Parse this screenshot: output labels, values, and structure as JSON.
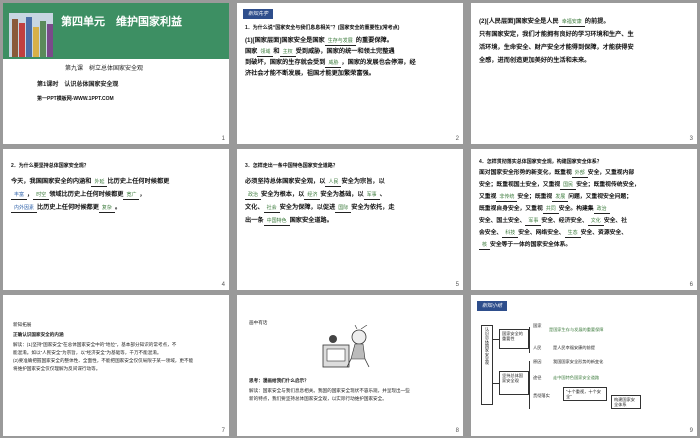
{
  "slides": [
    {
      "num": "1",
      "corner": "",
      "unit": "第四单元　维护国家利益",
      "lesson": "第九课　树立总体国家安全观",
      "period": "第1课时　认识总体国家安全观",
      "site": "第一PPT模板网-WWW.1PPT.COM"
    },
    {
      "num": "2",
      "corner": "",
      "tag": "新知先学",
      "q": "1．为什么说“国家安全与我们息息相关”？(国家安全的重要性)(常考点)",
      "l1": "(1)[国家层面]国家安全是国家",
      "a1": "生存与发展",
      "l1b": "的重要保障。",
      "l2a": "国家",
      "a2": "领域",
      "l2b": "和",
      "a3": "主权",
      "l2c": "受到威胁，国家的统一和领土完整遇",
      "l3": "到破坏，国家的生存就会受到",
      "a4": "威胁",
      "l3b": "，国家的发展也会停滞，经",
      "l4": "济社会才能不断发展，祖国才能更加繁荣富强。"
    },
    {
      "num": "3",
      "corner": "",
      "l1": "(2)[人民层面]国家安全是人民",
      "a1": "幸福安康",
      "l1b": "的前提。",
      "l2": "只有国家安定，我们才能拥有良好的学习环境和生产、生",
      "l3": "活环境，生命安全、财产安全才能得到保障，才能获得安",
      "l4": "全感，进而创造更加美好的生活和未来。"
    },
    {
      "num": "4",
      "corner": "",
      "q": "2．为什么要坚持总体国家安全观？",
      "l1": "今天，我国国家安全的内涵和",
      "a1": "外延",
      "l1b": "比历史上任何时候都更",
      "a2": "丰富",
      "l2b": "，",
      "a3": "时空",
      "l2c": "领域比历史上任何时候都更",
      "a4": "宽广",
      "a5": "内外因素",
      "l3b": "比历史上任何时候都更",
      "a6": "复杂"
    },
    {
      "num": "5",
      "corner": "",
      "q": "3．怎样走出一条中国特色国家安全道路？",
      "l1": "必须坚持总体国家安全观，以",
      "a1": "人民",
      "l1b": "安全为宗旨，以",
      "a2": "政治",
      "l2b": "安全为根本，以",
      "a3": "经济",
      "l2c": "安全为基础，以",
      "a4": "军事",
      "l3a": "文化、",
      "a5": "社会",
      "l3b": "安全为保障，以促进",
      "a6": "国际",
      "l3c": "安全为依托，走",
      "l4a": "出一条",
      "a7": "中国特色",
      "l4b": "国家安全道路。"
    },
    {
      "num": "6",
      "corner": "",
      "q": "4．怎样贯彻落实总体国家安全观，构建国家安全体系？",
      "l1": "面对国家安全形势的新变化，既重视",
      "a1": "外部",
      "l1b": "安全，又重视内部",
      "l2": "安全；既重视国土安全，又重视",
      "a2": "国民",
      "l2b": "安全；既重视传统安全，",
      "l3": "又重视",
      "a3": "非传统",
      "l3b": "安全；既重视",
      "a4": "发展",
      "l3c": "问题，又重视安全问题；",
      "l4": "既重视自身安全，又重视",
      "a5": "共同",
      "l4b": "安全。构建集",
      "a6": "政治",
      "l5": "安全、国土安全、",
      "a7": "军事",
      "l5b": "安全、经济安全、",
      "a8": "文化",
      "l5c": "安全、社",
      "l6": "会安全、",
      "a9": "科技",
      "l6b": "安全、网络安全、",
      "a10": "生态",
      "l6c": "安全、资源安全、",
      "a11": "核",
      "l7b": "安全等于一体的国家安全体系。"
    },
    {
      "num": "7",
      "corner": "",
      "title": "新知拓展",
      "sub": "正确认识国家安全的内涵",
      "l1": "解读：(1)坚持“国家安全”在总体国家安全中的“地位”，基本部分知识的常考点，不",
      "l2": "能混淆。如以“人民安全”为宗旨，以“经济安全”为基础等，千万不能混淆。",
      "l3": "(2)要准确把握国家安全的整体性、全面性，不能把国家安全仅仅局限于某一领域，更不能",
      "l4": "将维护国家安全仅仅理解为反间谍行动等。"
    },
    {
      "num": "8",
      "corner": "",
      "title": "画中有话",
      "l1": "思考：漫画给我们什么启示？",
      "l2": "解读：国家安全与我们息息相关。我国的国家安全现状不容乐观，并呈现出一些",
      "l3": "新的特点，我们要坚持总体国家安全观，以实际行动维护国家安全。"
    },
    {
      "num": "9",
      "corner": "",
      "tag": "新知小结",
      "root": "认识总体国家安全观",
      "b1": "国家安全的重要性",
      "b2": "坚持总体国家安全观",
      "n1": "国家",
      "n1a": "是国家生存与发展的重要保障",
      "n2": "人民",
      "n2a": "是人民幸福安康的前提",
      "n3": "原因",
      "n3a": "我国国家安全形势的新变化",
      "n4": "途径",
      "n4a": "走中国特色国家安全道路",
      "n5": "贯彻落实",
      "n5a": "“十个重视，十个安全”",
      "n5b": "构建国家安全体系"
    }
  ]
}
